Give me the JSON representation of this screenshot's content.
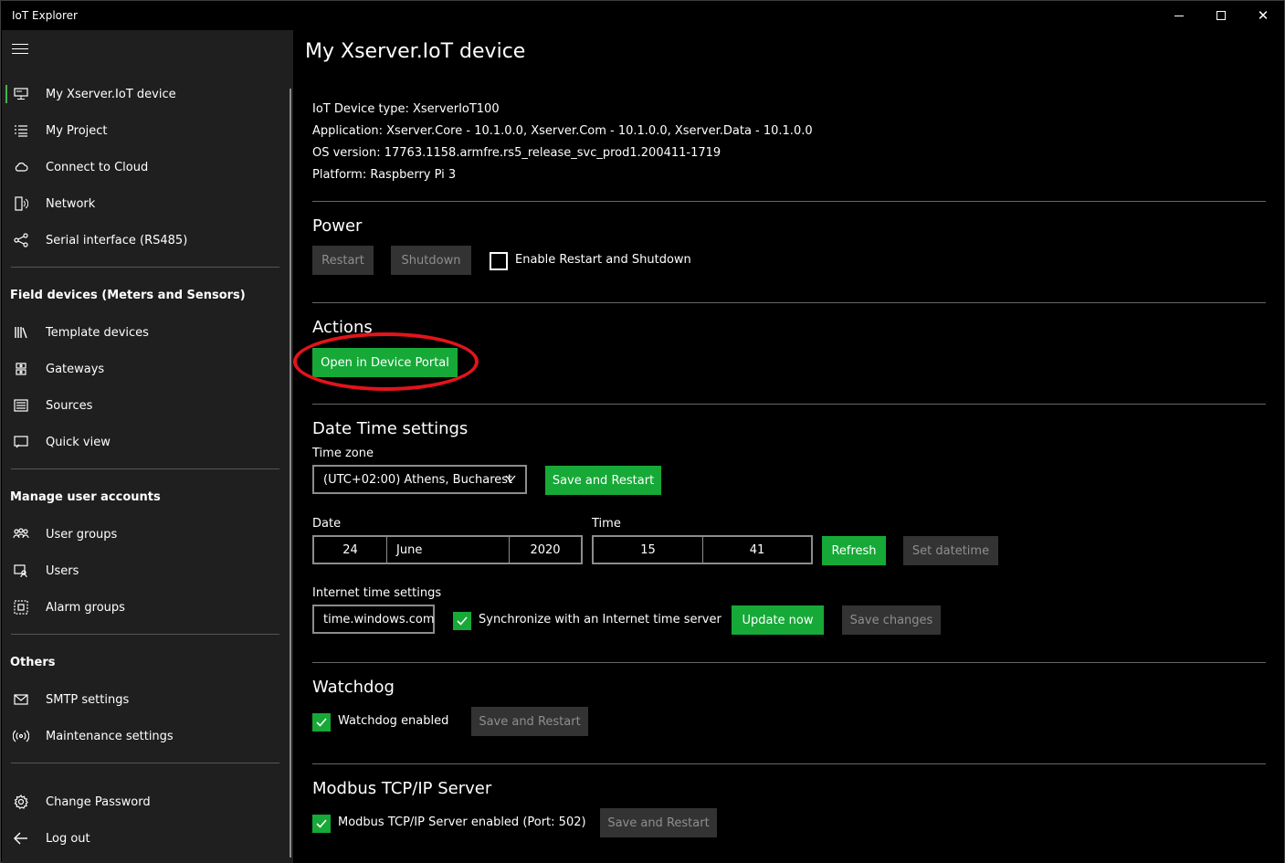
{
  "window": {
    "title": "IoT Explorer"
  },
  "sidebar": {
    "top_items": [
      {
        "label": "My Xserver.IoT device",
        "icon": "device-icon",
        "active": true
      },
      {
        "label": "My Project",
        "icon": "list-icon"
      },
      {
        "label": "Connect to Cloud",
        "icon": "cloud-icon"
      },
      {
        "label": "Network",
        "icon": "network-icon"
      },
      {
        "label": "Serial interface (RS485)",
        "icon": "share-icon"
      }
    ],
    "field_devices": {
      "heading": "Field devices (Meters and Sensors)",
      "items": [
        {
          "label": "Template devices",
          "icon": "library-icon"
        },
        {
          "label": "Gateways",
          "icon": "gateway-icon"
        },
        {
          "label": "Sources",
          "icon": "sources-icon"
        },
        {
          "label": "Quick view",
          "icon": "quick-view-icon"
        }
      ]
    },
    "user_accounts": {
      "heading": "Manage user accounts",
      "items": [
        {
          "label": "User groups",
          "icon": "people-icon"
        },
        {
          "label": "Users",
          "icon": "user-icon"
        },
        {
          "label": "Alarm groups",
          "icon": "alarm-group-icon"
        }
      ]
    },
    "others": {
      "heading": "Others",
      "items": [
        {
          "label": "SMTP settings",
          "icon": "mail-icon"
        },
        {
          "label": "Maintenance settings",
          "icon": "broadcast-icon"
        }
      ]
    },
    "bottom_items": [
      {
        "label": "Change Password",
        "icon": "gear-icon"
      },
      {
        "label": "Log out",
        "icon": "back-arrow-icon"
      }
    ]
  },
  "main": {
    "title": "My Xserver.IoT device",
    "info": {
      "device_type": "IoT Device type: XserverIoT100",
      "application": "Application: Xserver.Core - 10.1.0.0, Xserver.Com - 10.1.0.0, Xserver.Data - 10.1.0.0",
      "os_version": "OS version: 17763.1158.armfre.rs5_release_svc_prod1.200411-1719",
      "platform": "Platform: Raspberry Pi 3"
    },
    "power": {
      "title": "Power",
      "restart_label": "Restart",
      "shutdown_label": "Shutdown",
      "enable_label": "Enable Restart and Shutdown",
      "enable_checked": false
    },
    "actions": {
      "title": "Actions",
      "portal_label": "Open in Device Portal"
    },
    "datetime": {
      "title": "Date Time settings",
      "timezone_label": "Time zone",
      "timezone_value": "(UTC+02:00) Athens, Bucharest",
      "save_restart_label": "Save and Restart",
      "date_label": "Date",
      "day": "24",
      "month": "June",
      "year": "2020",
      "time_label": "Time",
      "hour": "15",
      "minute": "41",
      "refresh_label": "Refresh",
      "set_datetime_label": "Set datetime",
      "internet_label": "Internet time settings",
      "server_value": "time.windows.com",
      "sync_label": "Synchronize with an Internet time server",
      "sync_checked": true,
      "update_now_label": "Update now",
      "save_changes_label": "Save changes"
    },
    "watchdog": {
      "title": "Watchdog",
      "enabled_label": "Watchdog enabled",
      "enabled_checked": true,
      "save_restart_label": "Save and Restart"
    },
    "modbus": {
      "title": "Modbus TCP/IP Server",
      "enabled_label": "Modbus TCP/IP Server enabled (Port: 502)",
      "enabled_checked": true,
      "save_restart_label": "Save and Restart"
    }
  },
  "colors": {
    "accent_green": "#16a937",
    "sidebar_bg": "#1f1f1f",
    "annotation_red": "#e3141b"
  }
}
